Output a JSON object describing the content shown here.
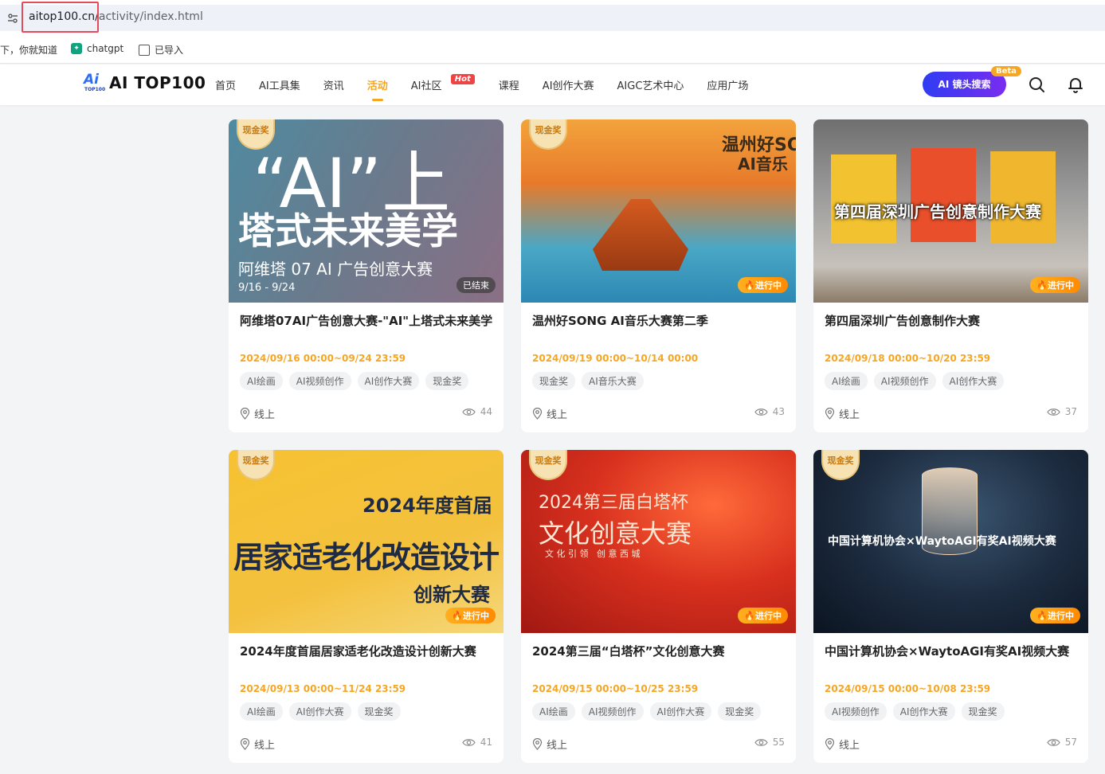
{
  "browser": {
    "url_domain": "aitop100.cn/",
    "url_path": "activity/index.html",
    "bookmarks": [
      {
        "label": "下，你就知道"
      },
      {
        "label": "chatgpt"
      },
      {
        "label": "已导入"
      }
    ]
  },
  "header": {
    "logo_text": "AI TOP100",
    "logo_mark": "Ai",
    "logo_sub": "TOP100",
    "nav": [
      {
        "label": "首页"
      },
      {
        "label": "AI工具集"
      },
      {
        "label": "资讯"
      },
      {
        "label": "活动",
        "active": true
      },
      {
        "label": "AI社区",
        "badge": "Hot"
      },
      {
        "label": "课程"
      },
      {
        "label": "AI创作大赛"
      },
      {
        "label": "AIGC艺术中心"
      },
      {
        "label": "应用广场"
      }
    ],
    "ai_search_label": "AI 镜头搜索",
    "beta_badge": "Beta"
  },
  "cards": [
    {
      "badge": "现金奖",
      "status": "已结束",
      "title": "阿维塔07AI广告创意大赛-\"AI\"上塔式未来美学",
      "date": "2024/09/16 00:00~09/24 23:59",
      "tags": [
        "AI绘画",
        "AI视频创作",
        "AI创作大赛",
        "现金奖"
      ],
      "location": "线上",
      "views": "44",
      "image_text": {
        "line1": "“AI”上",
        "line2": "塔式未来美学",
        "line3": "阿维塔 07 AI 广告创意大赛",
        "line4": "9/16 - 9/24"
      }
    },
    {
      "badge": "现金奖",
      "status": "进行中",
      "title": "温州好SONG AI音乐大赛第二季",
      "date": "2024/09/19 00:00~10/14 00:00",
      "tags": [
        "现金奖",
        "AI音乐大赛"
      ],
      "location": "线上",
      "views": "43",
      "image_text": {
        "line1": "温州好SO",
        "line2": "AI音乐"
      }
    },
    {
      "badge": "",
      "status": "进行中",
      "title": "第四届深圳广告创意制作大赛",
      "date": "2024/09/18 00:00~10/20 23:59",
      "tags": [
        "AI绘画",
        "AI视频创作",
        "AI创作大赛"
      ],
      "location": "线上",
      "views": "37",
      "image_text": {
        "line1": "第四届深圳广告创意制作大赛"
      }
    },
    {
      "badge": "现金奖",
      "status": "进行中",
      "title": "2024年度首届居家适老化改造设计创新大赛",
      "date": "2024/09/13 00:00~11/24 23:59",
      "tags": [
        "AI绘画",
        "AI创作大赛",
        "现金奖"
      ],
      "location": "线上",
      "views": "41",
      "image_text": {
        "line1": "2024年度首届",
        "line2": "居家适老化改造设计",
        "line3": "创新大赛"
      }
    },
    {
      "badge": "现金奖",
      "status": "进行中",
      "title": "2024第三届“白塔杯”文化创意大赛",
      "date": "2024/09/15 00:00~10/25 23:59",
      "tags": [
        "AI绘画",
        "AI视频创作",
        "AI创作大赛",
        "现金奖"
      ],
      "location": "线上",
      "views": "55",
      "image_text": {
        "line1": "2024第三届白塔杯",
        "line2": "文化创意大赛",
        "line3": "文 化 引 领   创 意 西 城"
      }
    },
    {
      "badge": "现金奖",
      "status": "进行中",
      "title": "中国计算机协会×WaytoAGI有奖AI视频大赛",
      "date": "2024/09/15 00:00~10/08 23:59",
      "tags": [
        "AI视频创作",
        "AI创作大赛",
        "现金奖"
      ],
      "location": "线上",
      "views": "57",
      "image_text": {
        "line1": "中国计算机协会×WaytoAGI有奖AI视频大赛"
      }
    }
  ]
}
